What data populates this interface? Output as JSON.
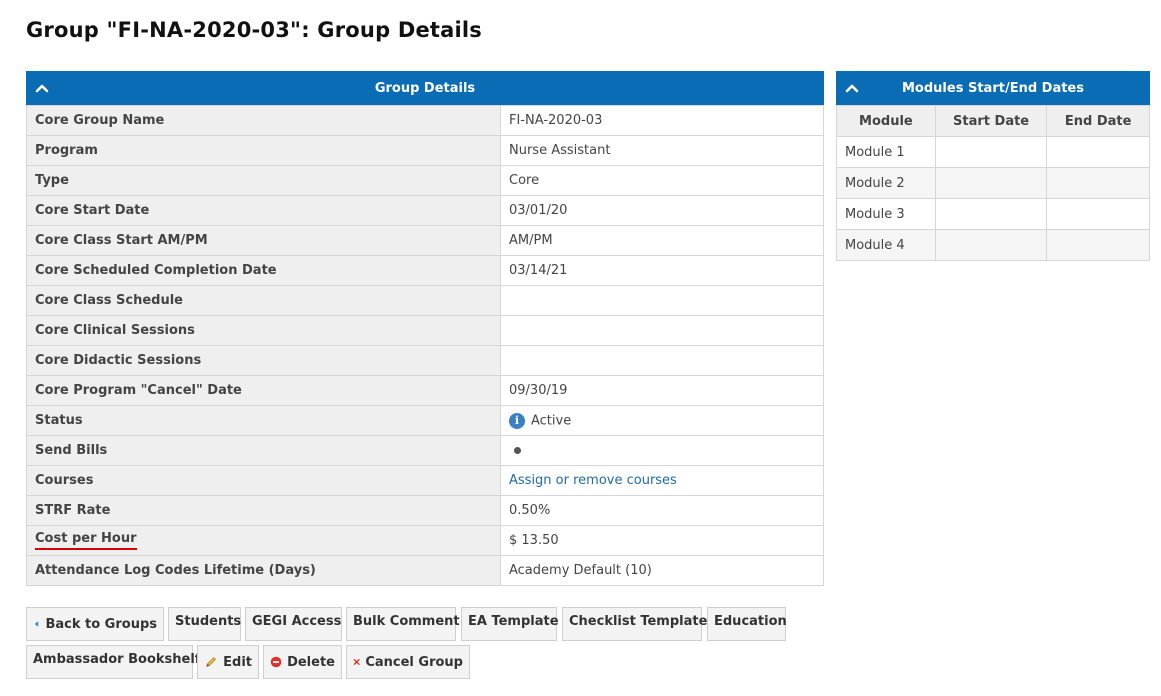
{
  "page": {
    "title": "Group \"FI-NA-2020-03\": Group Details"
  },
  "details": {
    "header": "Group Details",
    "rows": [
      {
        "label": "Core Group Name",
        "value": "FI-NA-2020-03"
      },
      {
        "label": "Program",
        "value": "Nurse Assistant"
      },
      {
        "label": "Type",
        "value": "Core"
      },
      {
        "label": "Core Start Date",
        "value": "03/01/20"
      },
      {
        "label": "Core Class Start AM/PM",
        "value": "AM/PM"
      },
      {
        "label": "Core Scheduled Completion Date",
        "value": "03/14/21"
      },
      {
        "label": "Core Class Schedule",
        "value": ""
      },
      {
        "label": "Core Clinical Sessions",
        "value": ""
      },
      {
        "label": "Core Didactic Sessions",
        "value": ""
      },
      {
        "label": "Core Program \"Cancel\" Date",
        "value": "09/30/19"
      },
      {
        "label": "Status",
        "value": "Active"
      },
      {
        "label": "Send Bills",
        "value": ""
      },
      {
        "label": "Courses",
        "value": "Assign or remove courses"
      },
      {
        "label": "STRF Rate",
        "value": "0.50%"
      },
      {
        "label": "Cost per Hour",
        "value": "$ 13.50"
      },
      {
        "label": "Attendance Log Codes Lifetime (Days)",
        "value": "Academy Default (10)"
      }
    ]
  },
  "modules": {
    "header": "Modules Start/End Dates",
    "columns": [
      "Module",
      "Start Date",
      "End Date"
    ],
    "rows": [
      {
        "module": "Module 1",
        "start": "",
        "end": ""
      },
      {
        "module": "Module 2",
        "start": "",
        "end": ""
      },
      {
        "module": "Module 3",
        "start": "",
        "end": ""
      },
      {
        "module": "Module 4",
        "start": "",
        "end": ""
      }
    ]
  },
  "buttons": {
    "back": "Back to Groups",
    "students": "Students",
    "gegi": "GEGI Access",
    "bulk_comment": "Bulk Comment",
    "ea_template": "EA Template",
    "checklist_template": "Checklist Template",
    "education": "Education",
    "ambassador": "Ambassador Bookshelf",
    "edit": "Edit",
    "delete": "Delete",
    "cancel_group": "Cancel Group"
  },
  "colors": {
    "header_bg": "#0a6cb4",
    "link": "#1f6aa8",
    "highlight_underline": "#d50000"
  }
}
